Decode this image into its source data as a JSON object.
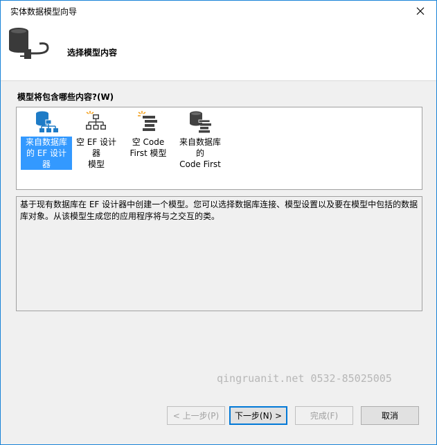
{
  "window": {
    "title": "实体数据模型向导",
    "close_icon": "close-icon"
  },
  "header": {
    "title": "选择模型内容",
    "icon": "database-plug-icon"
  },
  "content_section": {
    "label": "模型将包含哪些内容?(W)",
    "items": [
      {
        "label": "来自数据库\n的 EF 设计器",
        "icon": "database-designer-icon",
        "selected": true
      },
      {
        "label": "空 EF 设计器\n模型",
        "icon": "empty-designer-icon",
        "selected": false
      },
      {
        "label": "空 Code\nFirst 模型",
        "icon": "empty-code-first-icon",
        "selected": false
      },
      {
        "label": "来自数据库的\nCode First",
        "icon": "database-code-first-icon",
        "selected": false
      }
    ]
  },
  "description": "基于现有数据库在 EF 设计器中创建一个模型。您可以选择数据库连接、模型设置以及要在模型中包括的数据库对象。从该模型生成您的应用程序将与之交互的类。",
  "watermark": "qingruanit.net 0532-85025005",
  "buttons": {
    "back": "< 上一步(P)",
    "next": "下一步(N) >",
    "finish": "完成(F)",
    "cancel": "取消"
  },
  "colors": {
    "selection": "#3399ff",
    "icon_blue": "#1e7bc6",
    "icon_dark": "#424242",
    "icon_orange": "#f39c12"
  }
}
